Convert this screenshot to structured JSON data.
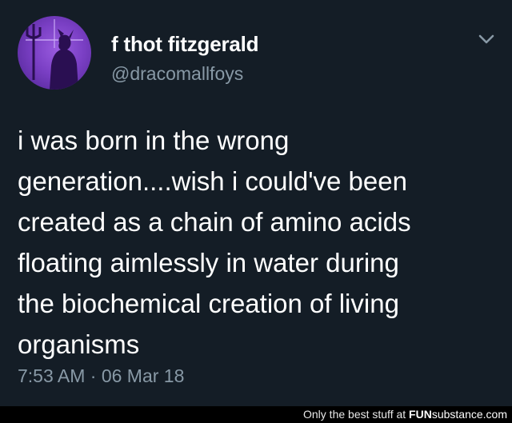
{
  "tweet": {
    "display_name": "f thot fitzgerald",
    "username": "@dracomallfoys",
    "text_lines": [
      "i was born in the wrong",
      "generation....wish i could've been",
      "created as a chain of amino acids",
      "floating aimlessly in water during",
      "the biochemical creation of living",
      "organisms"
    ],
    "timestamp": "7:53 AM · 06 Mar 18",
    "menu_icon": "chevron-down-icon",
    "avatar_icon": "avatar"
  },
  "watermark": {
    "prefix": "Only the best stuff at ",
    "brand_bold": "FUN",
    "brand_rest": "substance.com"
  },
  "colors": {
    "background": "#141d26",
    "primary_text": "#ffffff",
    "secondary_text": "#8899a6",
    "avatar_purple": "#7a3fc4"
  }
}
